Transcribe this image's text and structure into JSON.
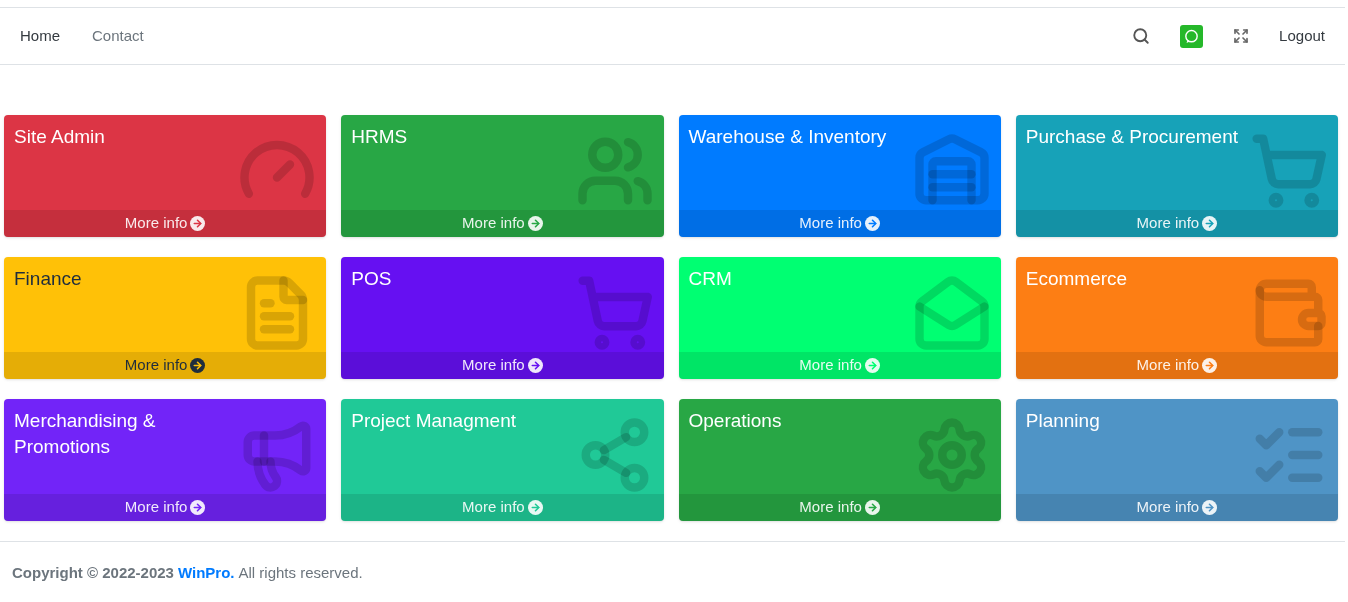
{
  "nav": {
    "links": [
      {
        "label": "Home",
        "selected": true
      },
      {
        "label": "Contact",
        "selected": false
      }
    ],
    "logout": "Logout"
  },
  "cards": [
    {
      "title": "Site Admin",
      "link": "More info",
      "color": "#dc3545"
    },
    {
      "title": "HRMS",
      "link": "More info",
      "color": "#28a745"
    },
    {
      "title": "Warehouse & Inventory",
      "link": "More info",
      "color": "#007bff"
    },
    {
      "title": "Purchase & Procurement",
      "link": "More info",
      "color": "#17a2b8"
    },
    {
      "title": "Finance",
      "link": "More info",
      "color": "#ffc107"
    },
    {
      "title": "POS",
      "link": "More info",
      "color": "#6610f2"
    },
    {
      "title": "CRM",
      "link": "More info",
      "color": "#00ff72"
    },
    {
      "title": "Ecommerce",
      "link": "More info",
      "color": "#fd7e14"
    },
    {
      "title": "Merchandising & Promotions",
      "link": "More info",
      "color": "#7224f8"
    },
    {
      "title": "Project Managment",
      "link": "More info",
      "color": "#20c997"
    },
    {
      "title": "Operations",
      "link": "More info",
      "color": "#28a745"
    },
    {
      "title": "Planning",
      "link": "More info",
      "color": "#4f94c6"
    }
  ],
  "footer": {
    "prefix": "Copyright © 2022-2023",
    "link": "WinPro.",
    "suffix": "All rights reserved."
  }
}
